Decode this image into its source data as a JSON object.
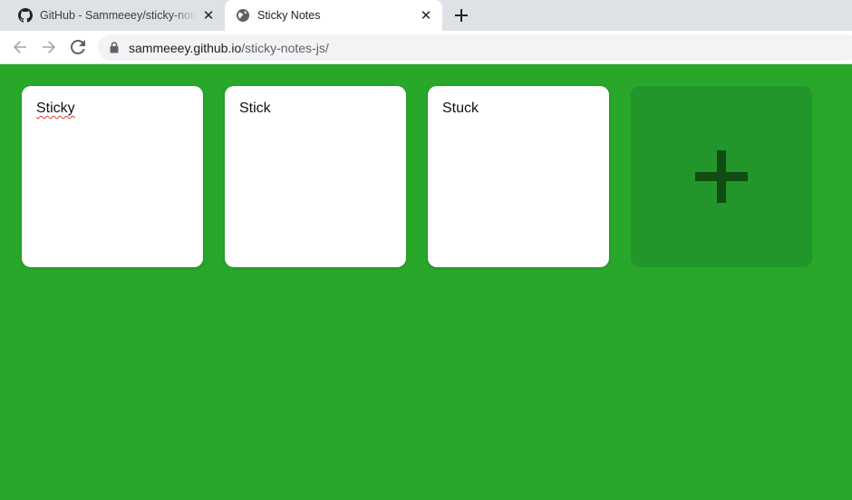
{
  "browser": {
    "tabs": [
      {
        "title": "GitHub - Sammeeey/sticky-notes-js",
        "icon": "github-icon",
        "active": false
      },
      {
        "title": "Sticky Notes",
        "icon": "globe-icon",
        "active": true
      }
    ],
    "new_tab_icon": "plus-icon",
    "address_bar": {
      "host": "sammeeey.github.io",
      "path": "/sticky-notes-js/",
      "icon": "lock-icon"
    },
    "colors": {
      "tabstrip": "#dee1e6",
      "omnibox": "#f1f3f4"
    }
  },
  "app": {
    "notes": [
      {
        "text": "Sticky",
        "spellcheck_error": true
      },
      {
        "text": "Stick",
        "spellcheck_error": false
      },
      {
        "text": "Stuck",
        "spellcheck_error": false
      }
    ],
    "add_button_icon": "plus-icon",
    "colors": {
      "background": "#28a72a",
      "add_button": "#22962a",
      "add_icon": "#0f4d12",
      "note": "#ffffff"
    }
  }
}
